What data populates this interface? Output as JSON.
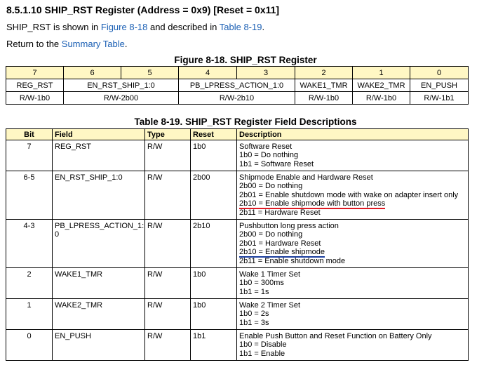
{
  "heading": "8.5.1.10 SHIP_RST Register (Address = 0x9) [Reset = 0x11]",
  "intro": {
    "prefix": "SHIP_RST is shown in ",
    "figure_link": "Figure 8-18",
    "middle": " and described in ",
    "table_link": "Table 8-19",
    "suffix": "."
  },
  "return_line": {
    "prefix": "Return to the ",
    "link": "Summary Table",
    "suffix": "."
  },
  "figure": {
    "caption": "Figure 8-18. SHIP_RST Register",
    "bits": [
      "7",
      "6",
      "5",
      "4",
      "3",
      "2",
      "1",
      "0"
    ],
    "fields": [
      "REG_RST",
      "EN_RST_SHIP_1:0",
      "PB_LPRESS_ACTION_1:0",
      "WAKE1_TMR",
      "WAKE2_TMR",
      "EN_PUSH"
    ],
    "resets": [
      "R/W-1b0",
      "R/W-2b00",
      "R/W-2b10",
      "R/W-1b0",
      "R/W-1b0",
      "R/W-1b1"
    ],
    "header_color": "#fff7c4"
  },
  "table": {
    "caption": "Table 8-19. SHIP_RST Register Field Descriptions",
    "headers": [
      "Bit",
      "Field",
      "Type",
      "Reset",
      "Description"
    ],
    "rows": [
      {
        "bit": "7",
        "field": "REG_RST",
        "type": "R/W",
        "reset": "1b0",
        "desc": [
          "Software Reset",
          "1b0 = Do nothing",
          "1b1 = Software Reset"
        ]
      },
      {
        "bit": "6-5",
        "field": "EN_RST_SHIP_1:0",
        "type": "R/W",
        "reset": "2b00",
        "desc": [
          "Shipmode Enable and Hardware Reset",
          "2b00 = Do nothing",
          "2b01 = Enable shutdown mode with wake on adapter insert only",
          "2b10 = Enable shipmode with button press",
          "2b11 = Hardware Reset"
        ]
      },
      {
        "bit": "4-3",
        "field": "PB_LPRESS_ACTION_1:",
        "field2": "0",
        "type": "R/W",
        "reset": "2b10",
        "desc": [
          "Pushbutton long press action",
          "2b00 = Do nothing",
          "2b01 = Hardware Reset",
          "2b10 = Enable shipmode",
          "2b11 = Enable shutdown mode"
        ]
      },
      {
        "bit": "2",
        "field": "WAKE1_TMR",
        "type": "R/W",
        "reset": "1b0",
        "desc": [
          "Wake 1 Timer Set",
          "1b0 = 300ms",
          "1b1 = 1s"
        ]
      },
      {
        "bit": "1",
        "field": "WAKE2_TMR",
        "type": "R/W",
        "reset": "1b0",
        "desc": [
          "Wake 2 Timer Set",
          "1b0 = 2s",
          "1b1 = 3s"
        ]
      },
      {
        "bit": "0",
        "field": "EN_PUSH",
        "type": "R/W",
        "reset": "1b1",
        "desc": [
          "Enable Push Button and Reset Function on Battery Only",
          "1b0 = Disable",
          "1b1 = Enable"
        ]
      }
    ],
    "annotation_colors": {
      "red_underline": "#e01b24",
      "blue_underline": "#1c3f9e"
    }
  }
}
